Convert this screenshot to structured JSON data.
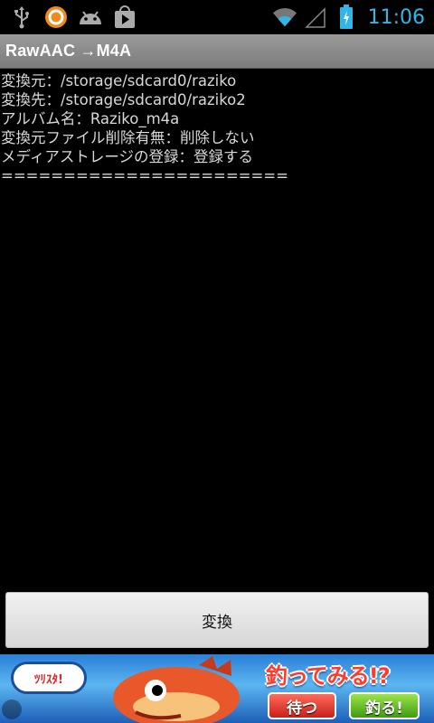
{
  "status_bar": {
    "time": "11:06",
    "icons_left": [
      "usb-icon",
      "app-notification-icon",
      "android-debug-icon",
      "play-store-icon"
    ],
    "icons_right": [
      "wifi-icon",
      "signal-icon",
      "battery-charging-icon"
    ],
    "accent_color": "#33b5e5"
  },
  "title_bar": {
    "title": "RawAAC →M4A"
  },
  "info": {
    "lines": [
      "変換元：/storage/sdcard0/raziko",
      "変換先：/storage/sdcard0/raziko2",
      "アルバム名：Raziko_m4a",
      "変換元ファイル削除有無：削除しない",
      "メディアストレージの登録：登録する",
      "======================="
    ]
  },
  "convert_button": {
    "label": "変換"
  },
  "ad_banner": {
    "logo_text": "ﾂﾘｽﾀ!",
    "headline": "釣ってみる!?",
    "wait_button": "待つ",
    "reel_button": "釣る!"
  }
}
